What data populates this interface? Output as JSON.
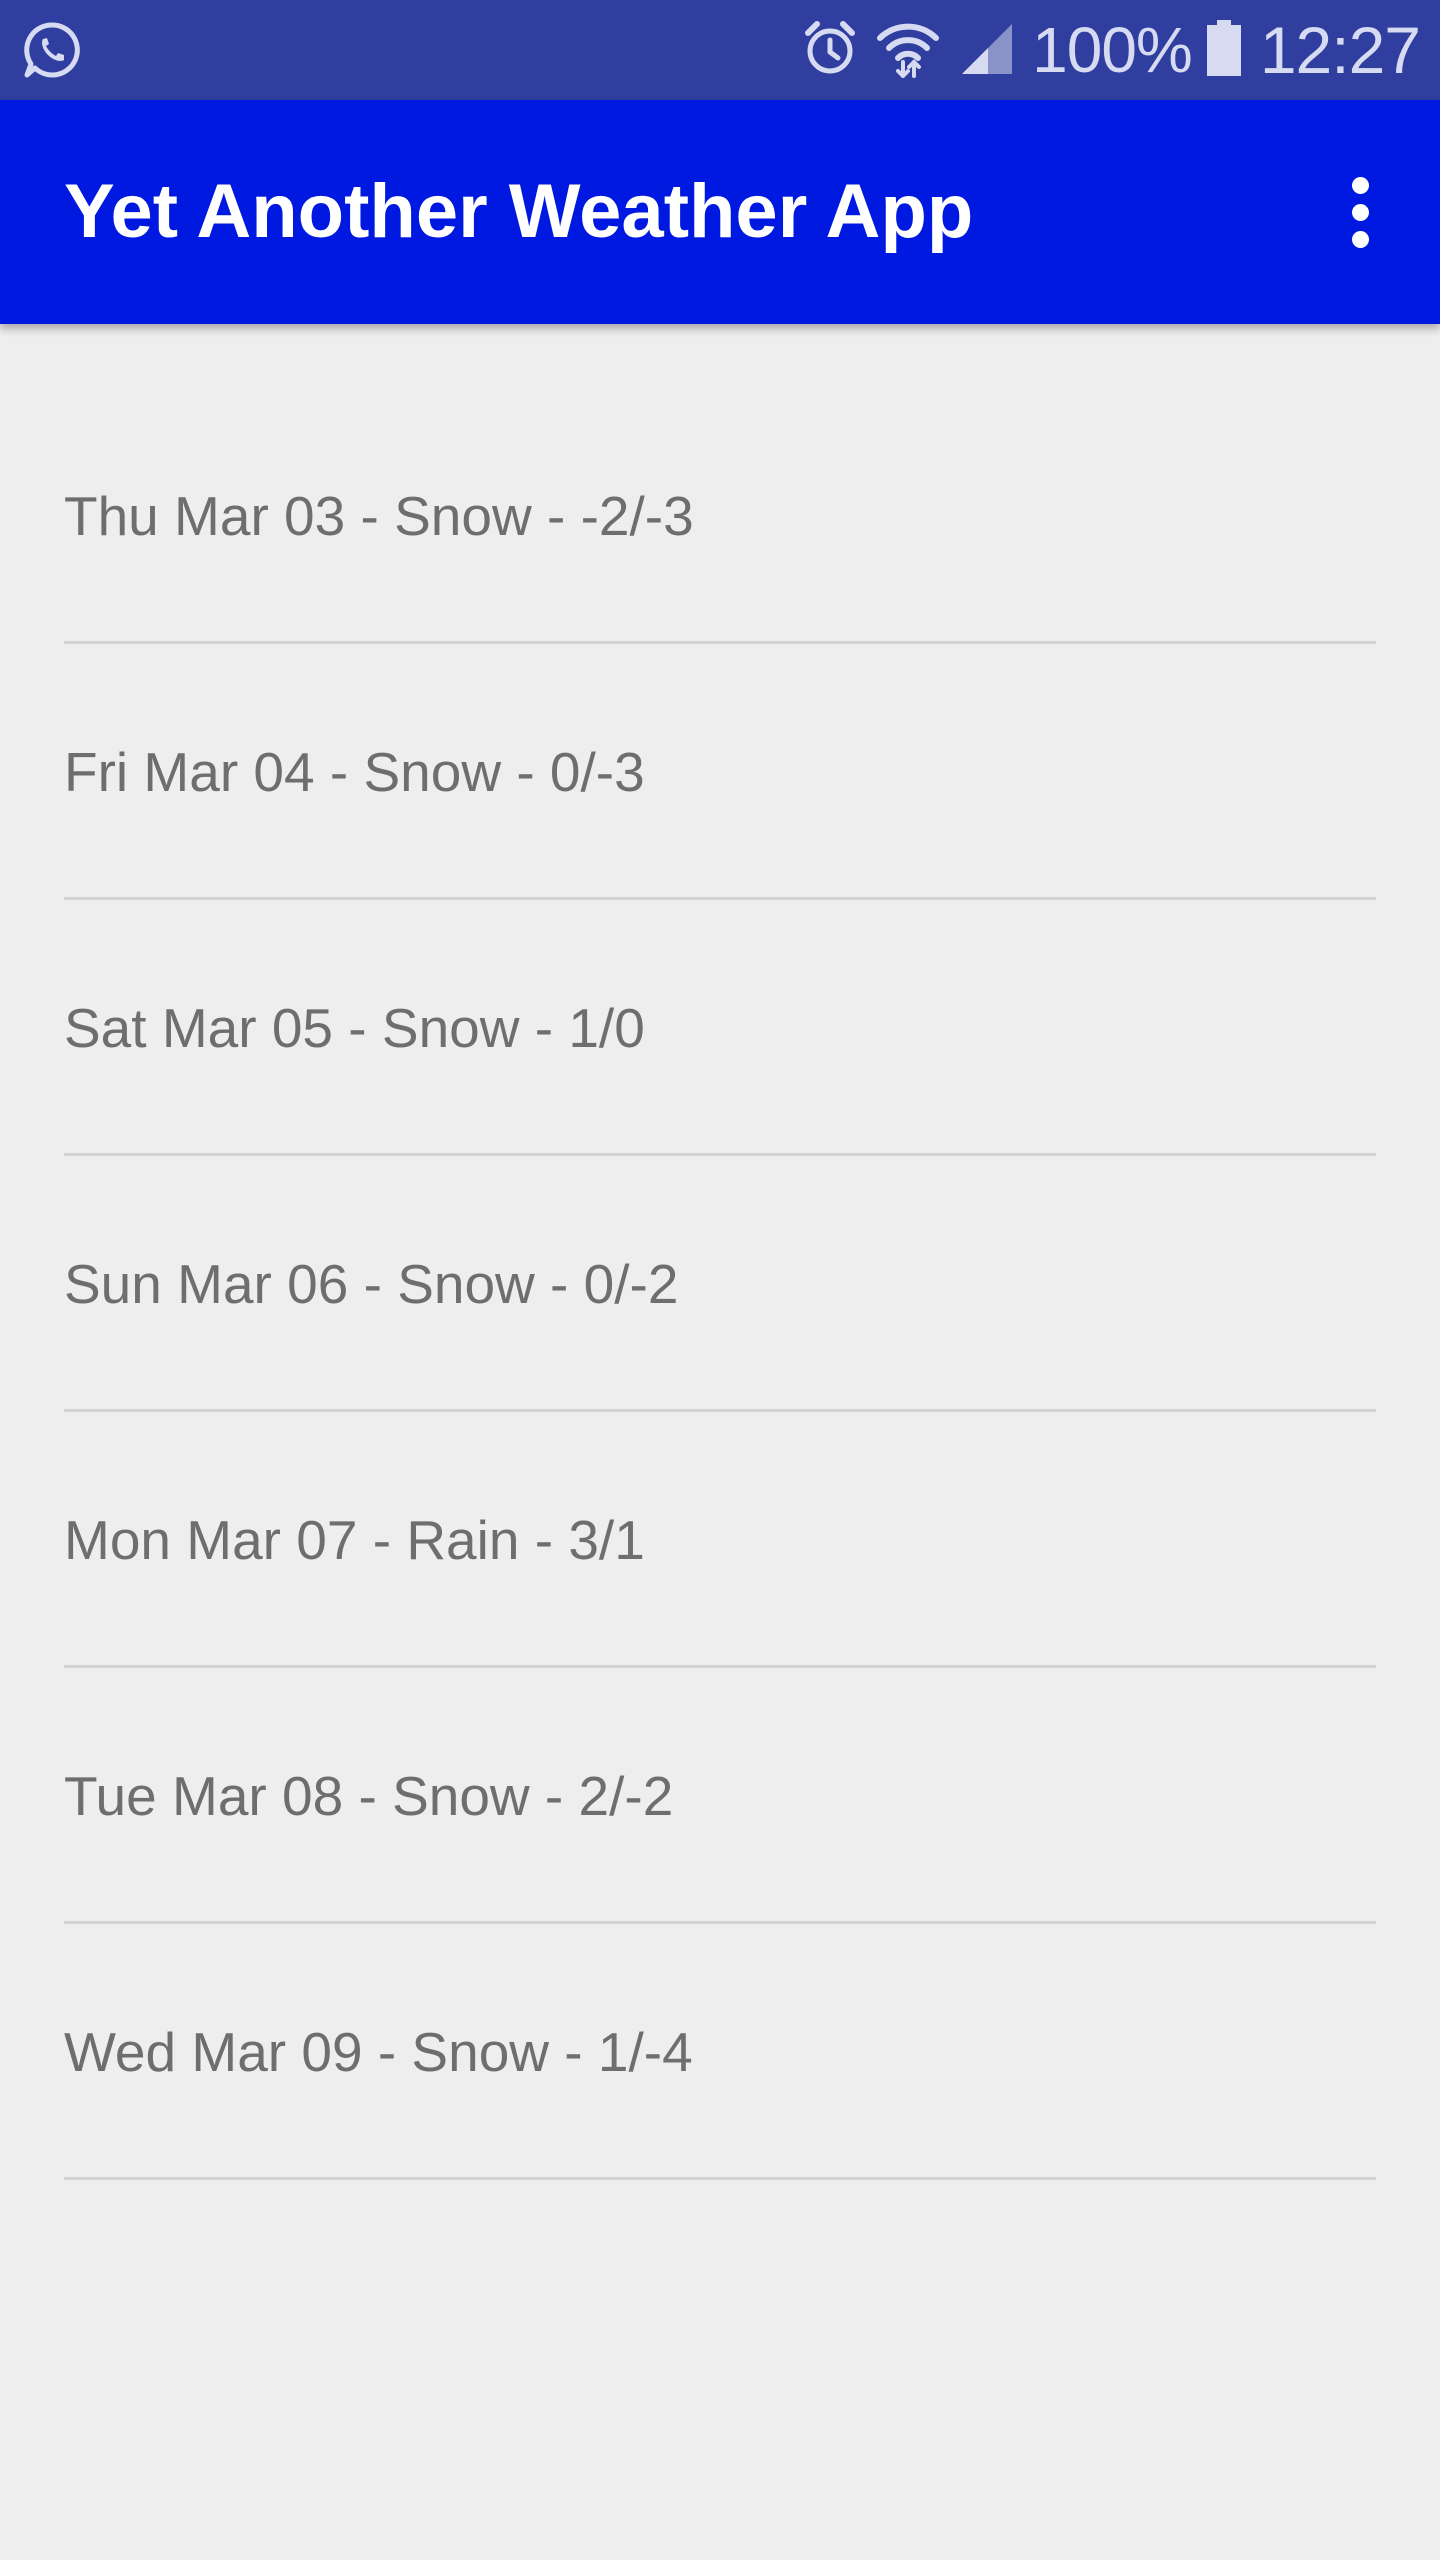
{
  "status_bar": {
    "app_icon": "whatsapp-icon",
    "icons": [
      "alarm-icon",
      "wifi-icon",
      "cell-signal-icon",
      "battery-icon"
    ],
    "battery_percent": "100%",
    "time": "12:27",
    "colors": {
      "background": "#2f3e9f",
      "foreground": "#d6dbf2"
    }
  },
  "app_bar": {
    "title": "Yet Another Weather App",
    "menu_icon": "more-vert-icon",
    "colors": {
      "background": "#0019e0",
      "foreground": "#ffffff"
    }
  },
  "forecast": {
    "items": [
      {
        "label": "Thu Mar 03 - Snow - -2/-3"
      },
      {
        "label": "Fri Mar 04 - Snow - 0/-3"
      },
      {
        "label": "Sat Mar 05 - Snow - 1/0"
      },
      {
        "label": "Sun Mar 06 - Snow - 0/-2"
      },
      {
        "label": "Mon Mar 07 - Rain - 3/1"
      },
      {
        "label": "Tue Mar 08 - Snow - 2/-2"
      },
      {
        "label": "Wed Mar 09 - Snow - 1/-4"
      }
    ],
    "colors": {
      "text": "#6e6e6e",
      "divider": "#d2d2d2",
      "background": "#eeeeee"
    }
  }
}
